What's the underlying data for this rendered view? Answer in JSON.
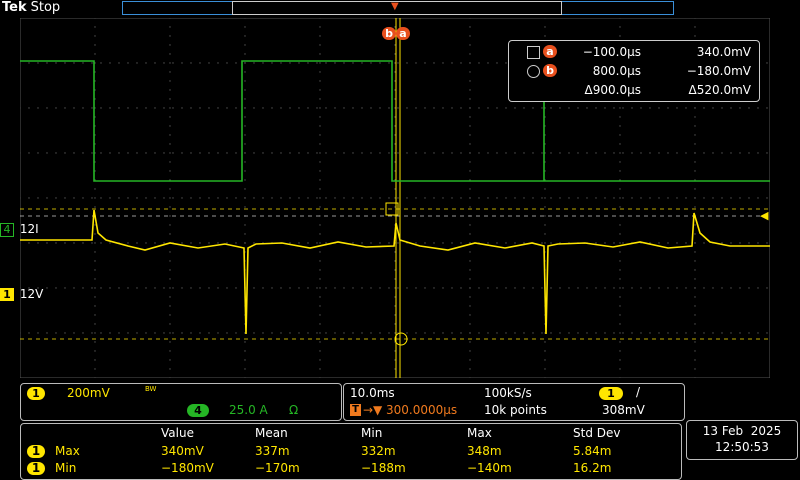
{
  "header": {
    "brand": "Tek",
    "status": "Stop"
  },
  "cursor_readout": {
    "a": {
      "label": "a",
      "time": "−100.0µs",
      "value": "340.0mV"
    },
    "b": {
      "label": "b",
      "time": "800.0µs",
      "value": "−180.0mV"
    },
    "delta": {
      "time": "Δ900.0µs",
      "value": "Δ520.0mV"
    }
  },
  "channels": {
    "ch4": {
      "number": "4",
      "label": "12I",
      "color": "#25b625"
    },
    "ch1": {
      "number": "1",
      "label": "12V",
      "color": "#ffe600"
    }
  },
  "cursor_marker": {
    "b": "b",
    "a": "a"
  },
  "vertical_panel": {
    "ch1": {
      "number": "1",
      "scale": "200mV",
      "bw": "BW"
    },
    "ch4": {
      "number": "4",
      "scale": "25.0 A",
      "unit": "Ω"
    }
  },
  "horizontal_panel": {
    "timebase": "10.0ms",
    "sample_rate": "100kS/s",
    "trigger_pos": "300.0000µs",
    "record_length": "10k points",
    "trigger_channel": "1",
    "trigger_slope": "/",
    "trigger_level": "308mV"
  },
  "measurements": {
    "headers": [
      "Value",
      "Mean",
      "Min",
      "Max",
      "Std Dev"
    ],
    "rows": [
      {
        "channel": "1",
        "name": "Max",
        "values": [
          "340mV",
          "337m",
          "332m",
          "348m",
          "5.84m"
        ]
      },
      {
        "channel": "1",
        "name": "Min",
        "values": [
          "−180mV",
          "−170m",
          "−188m",
          "−140m",
          "16.2m"
        ]
      }
    ]
  },
  "datetime": {
    "date": "13 Feb  2025",
    "time": "12:50:53"
  },
  "colors": {
    "ch1": "#ffe600",
    "ch4": "#25b625",
    "cursor": "#ffe600",
    "marker": "#e8501e",
    "grid": "#555555"
  }
}
